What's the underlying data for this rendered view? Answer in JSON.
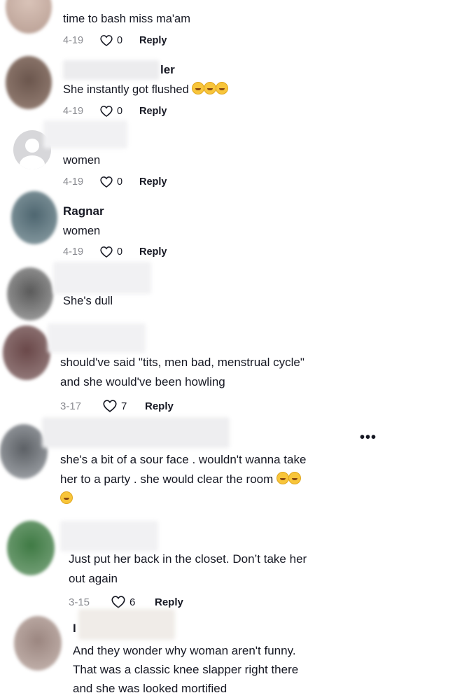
{
  "comments": [
    {
      "name": "",
      "text": [
        "time to bash miss ma'am"
      ],
      "date": "4-19",
      "likes": "0",
      "reply": "Reply"
    },
    {
      "name": "ler",
      "text": [
        "She instantly got flushed"
      ],
      "emoji_count": 3,
      "date": "4-19",
      "likes": "0",
      "reply": "Reply"
    },
    {
      "name": "",
      "text": [
        "women"
      ],
      "date": "4-19",
      "likes": "0",
      "reply": "Reply"
    },
    {
      "name": "Ragnar",
      "text": [
        "women"
      ],
      "date": "4-19",
      "likes": "0",
      "reply": "Reply"
    },
    {
      "name": "",
      "text": [
        "She's dull"
      ]
    },
    {
      "name": "",
      "text": [
        "should've said \"tits, men bad, menstrual cycle\"",
        "and she would've been howling"
      ],
      "date": "3-17",
      "likes": "7",
      "reply": "Reply"
    },
    {
      "name": "",
      "text": [
        "she's a bit of a sour face . wouldn't wanna take",
        "her to a party . she would clear the room"
      ],
      "emoji_count": 3,
      "more_icon": "more-options-icon"
    },
    {
      "name": "",
      "text": [
        "Just put her back in the closet. Don’t take her",
        "out again"
      ],
      "date": "3-15",
      "likes": "6",
      "reply": "Reply"
    },
    {
      "name": "I",
      "text": [
        "And they wonder why woman aren't funny.",
        "That was a classic knee slapper right there",
        "and she was looked mortified"
      ]
    }
  ],
  "colors": {
    "text": "#161823",
    "meta": "#8a8b91",
    "background": "#ffffff"
  }
}
